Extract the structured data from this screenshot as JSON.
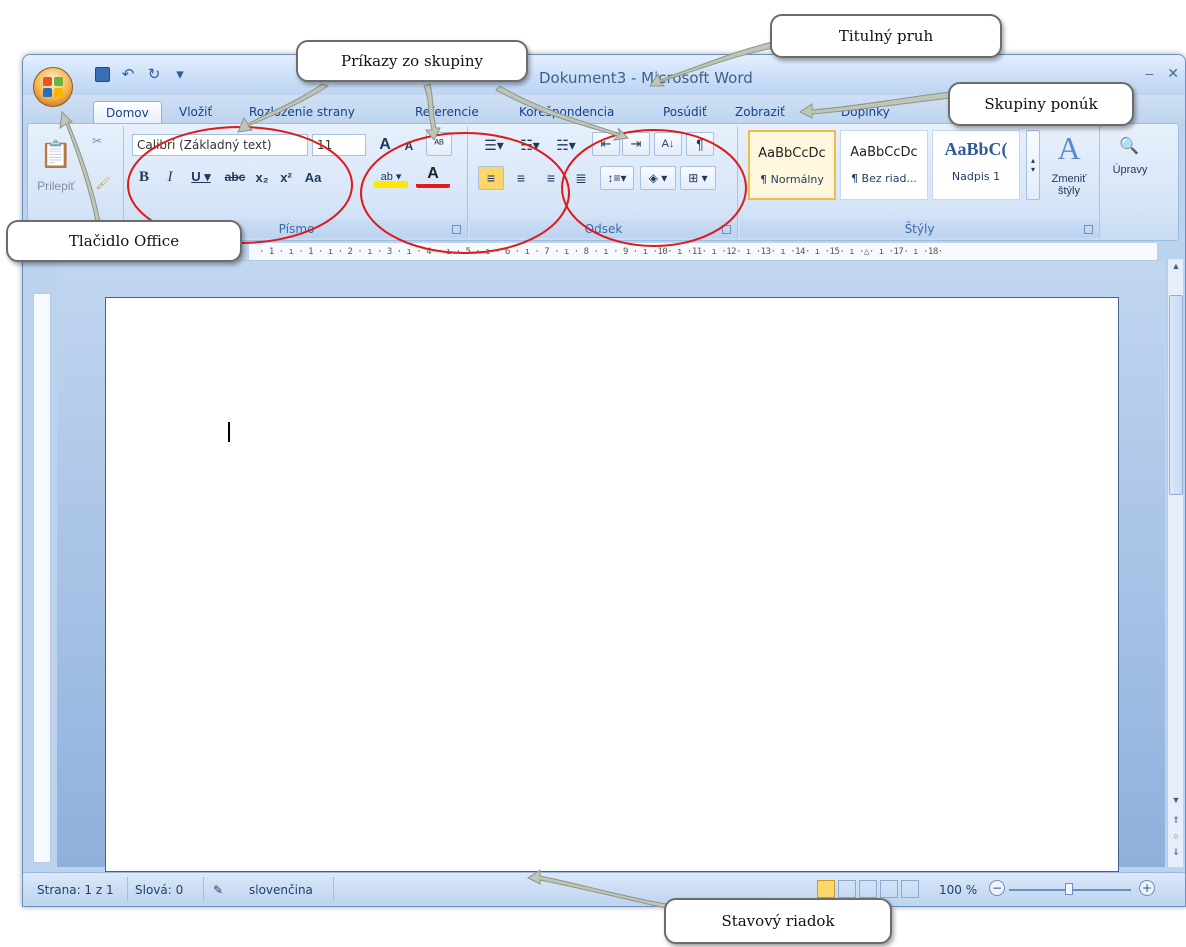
{
  "window": {
    "title": "Dokument3 - Microsoft Word",
    "tabs": [
      "Domov",
      "Vložiť",
      "Rozloženie strany",
      "Referencie",
      "Korešpondencia",
      "Posúdiť",
      "Zobraziť",
      "Doplnky"
    ],
    "active_tab": "Domov"
  },
  "ribbon": {
    "clipboard": {
      "paste_label": "Prilepiť"
    },
    "font": {
      "label": "Písmo",
      "font_name": "Calibri (Základný text)",
      "font_size": "11"
    },
    "paragraph": {
      "label": "Odsek"
    },
    "styles": {
      "label": "Štýly",
      "items": [
        {
          "sample": "AaBbCcDc",
          "name": "¶ Normálny"
        },
        {
          "sample": "AaBbCcDc",
          "name": "¶ Bez riad..."
        },
        {
          "sample": "AaBbC(",
          "name": "Nadpis 1"
        }
      ],
      "change_styles": "Zmeniť štýly",
      "editing": "Úpravy"
    }
  },
  "ruler": {
    "text": "· 1 · ı · 1 · ı · 2 · ı · 3 · ı · 4 · ı · 5 · ı · 6 · ı · 7 · ı · 8 · ı · 9 · ı ·10· ı ·11· ı ·12· ı ·13· ı ·14· ı ·15· ı ·△· ı ·17· ı ·18·"
  },
  "status_bar": {
    "page": "Strana: 1 z 1",
    "words": "Slová: 0",
    "language": "slovenčina",
    "zoom": "100 %"
  },
  "callouts": {
    "title_bar": "Titulný pruh",
    "group_commands": "Príkazy zo skupiny",
    "menu_groups": "Skupiny ponúk",
    "office_button": "Tlačidlo Office",
    "status_bar": "Stavový riadok"
  },
  "colors": {
    "accent": "#1e395b",
    "ellipse": "#e01919",
    "ribbon": "#dbe7f7"
  }
}
